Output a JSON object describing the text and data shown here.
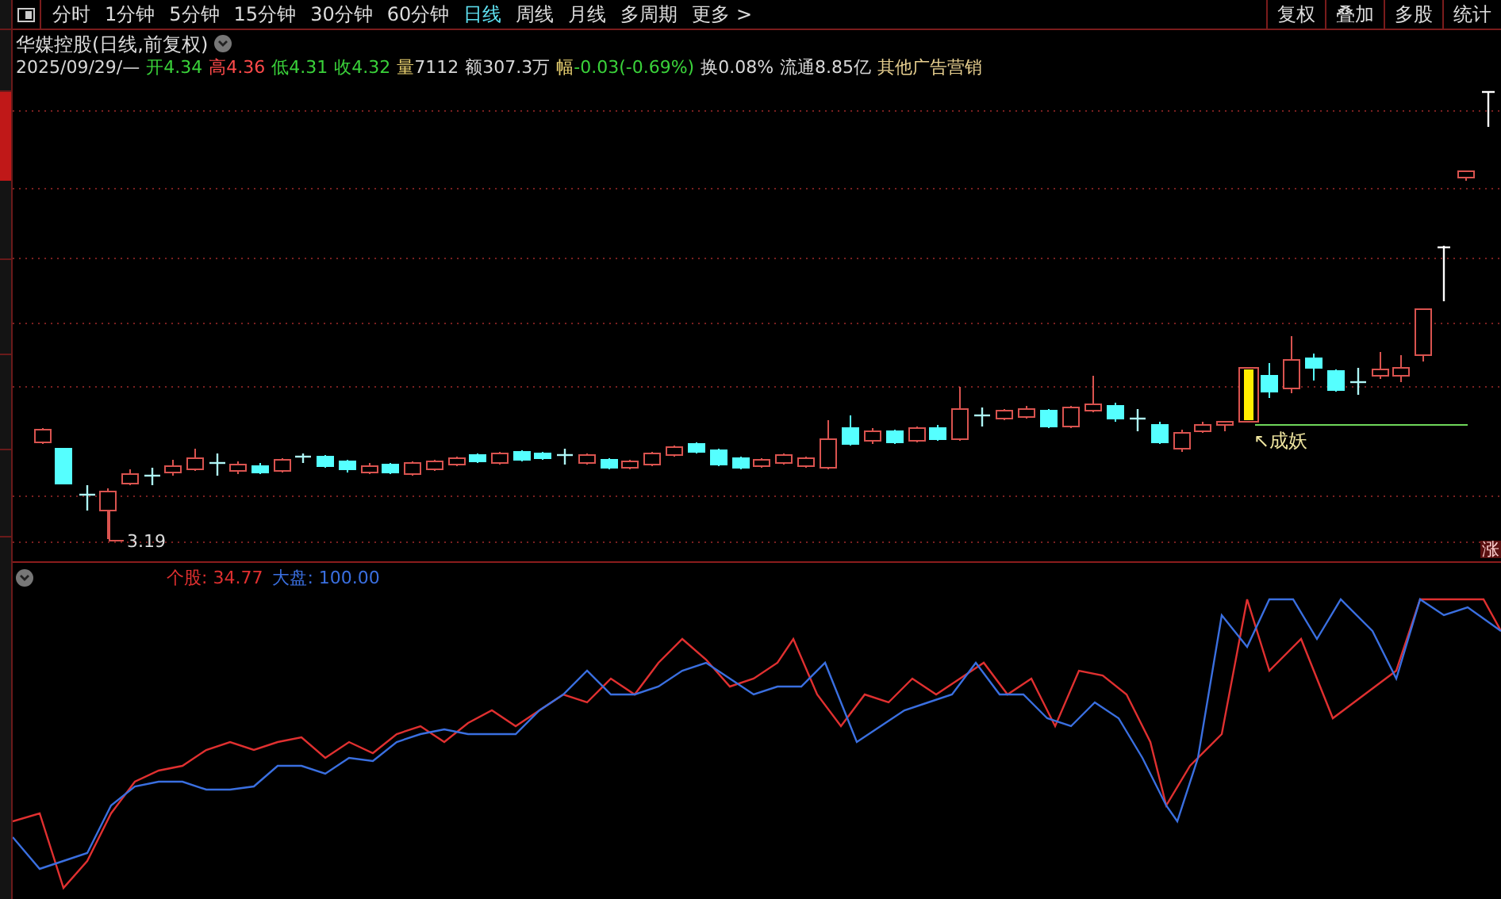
{
  "toolbar": {
    "tabs": [
      {
        "label": "分时",
        "selected": false
      },
      {
        "label": "1分钟",
        "selected": false
      },
      {
        "label": "5分钟",
        "selected": false
      },
      {
        "label": "15分钟",
        "selected": false
      },
      {
        "label": "30分钟",
        "selected": false
      },
      {
        "label": "60分钟",
        "selected": false
      },
      {
        "label": "日线",
        "selected": true
      },
      {
        "label": "周线",
        "selected": false
      },
      {
        "label": "月线",
        "selected": false
      },
      {
        "label": "多周期",
        "selected": false
      },
      {
        "label": "更多 >",
        "selected": false
      }
    ],
    "buttons": [
      "复权",
      "叠加",
      "多股",
      "统计"
    ]
  },
  "chart_header": {
    "title": "华媒控股(日线,前复权)",
    "date": "2025/09/29/—",
    "quote": [
      {
        "parts": [
          {
            "text": "开4.34",
            "color": "#3ad23a"
          }
        ]
      },
      {
        "parts": [
          {
            "text": "高",
            "color": "#ff4a4a"
          },
          {
            "text": "4.36",
            "color": "#ff4a4a"
          }
        ]
      },
      {
        "parts": [
          {
            "text": "低4.31",
            "color": "#3ad23a"
          }
        ]
      },
      {
        "parts": [
          {
            "text": "收4.32",
            "color": "#3ad23a"
          }
        ]
      },
      {
        "parts": [
          {
            "text": "量",
            "color": "#e8d070"
          },
          {
            "text": "7112",
            "color": "#d8d8d8"
          }
        ]
      },
      {
        "parts": [
          {
            "text": "额307.3万",
            "color": "#d8d8d8"
          }
        ]
      },
      {
        "parts": [
          {
            "text": "幅",
            "color": "#e8d070"
          },
          {
            "text": "-0.03(-0.69%)",
            "color": "#3ad23a"
          }
        ]
      },
      {
        "parts": [
          {
            "text": "换0.08%",
            "color": "#d8d8d8"
          }
        ]
      },
      {
        "parts": [
          {
            "text": "流通8.85亿",
            "color": "#d8d8d8"
          }
        ]
      }
    ],
    "sector": "其他广告营销"
  },
  "price_pane": {
    "low_label": "3.19",
    "signal_label": "↖成妖",
    "badge": "涨"
  },
  "compare_pane": {
    "legend": [
      {
        "label": "个股: 34.77",
        "color": "#e03030"
      },
      {
        "label": "大盘: 100.00",
        "color": "#3a6fe0"
      }
    ]
  }
}
